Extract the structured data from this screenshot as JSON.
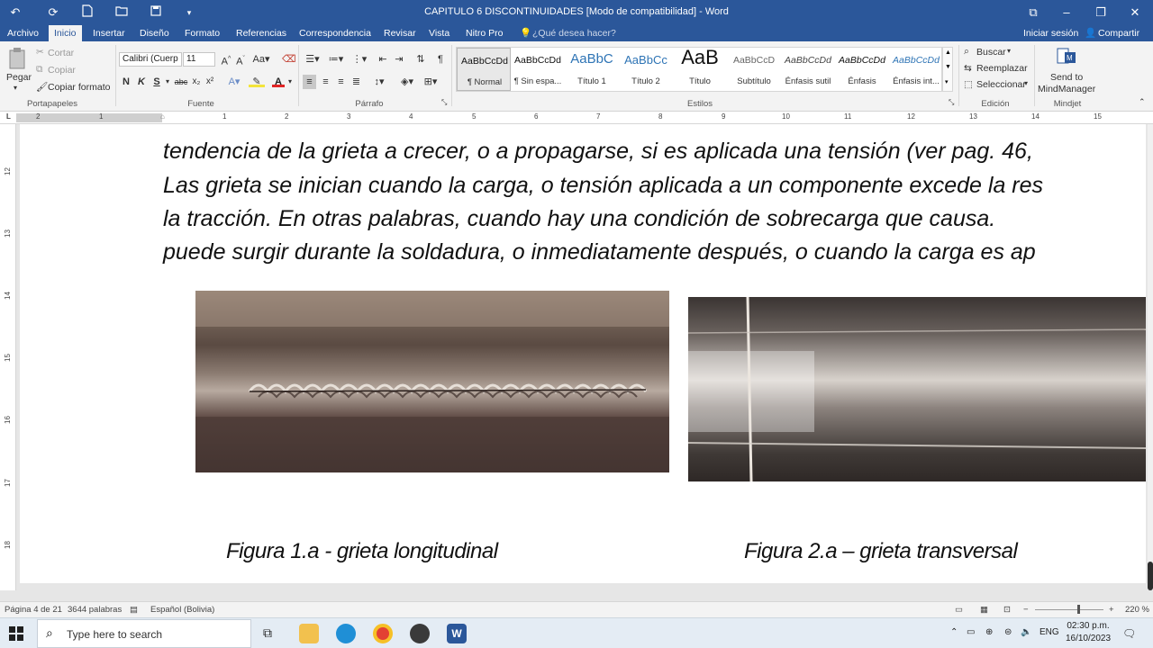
{
  "titlebar": {
    "title": "CAPITULO 6 DISCONTINUIDADES [Modo de compatibilidad] - Word"
  },
  "tabs": {
    "items": [
      "Archivo",
      "Inicio",
      "Insertar",
      "Diseño",
      "Formato",
      "Referencias",
      "Correspondencia",
      "Revisar",
      "Vista",
      "Nitro Pro"
    ],
    "tell_me": "¿Qué desea hacer?",
    "sign_in": "Iniciar sesión",
    "share": "Compartir"
  },
  "ribbon": {
    "clipboard": {
      "paste": "Pegar",
      "cut": "Cortar",
      "copy": "Copiar",
      "format_painter": "Copiar formato",
      "label": "Portapapeles"
    },
    "font": {
      "family": "Calibri (Cuerp",
      "size": "11",
      "label": "Fuente",
      "bold": "N",
      "italic": "K",
      "underline": "S"
    },
    "paragraph": {
      "label": "Párrafo"
    },
    "styles": {
      "label": "Estilos",
      "items": [
        {
          "preview": "AaBbCcDd",
          "name": "¶ Normal"
        },
        {
          "preview": "AaBbCcDd",
          "name": "¶ Sin espa..."
        },
        {
          "preview": "AaBbC",
          "name": "Título 1"
        },
        {
          "preview": "AaBbCc",
          "name": "Título 2"
        },
        {
          "preview": "AaB",
          "name": "Título"
        },
        {
          "preview": "AaBbCcD",
          "name": "Subtítulo"
        },
        {
          "preview": "AaBbCcDd",
          "name": "Énfasis sutil"
        },
        {
          "preview": "AaBbCcDd",
          "name": "Énfasis"
        },
        {
          "preview": "AaBbCcDd",
          "name": "Énfasis int..."
        }
      ]
    },
    "editing": {
      "label": "Edición",
      "find": "Buscar",
      "replace": "Reemplazar",
      "select": "Seleccionar"
    },
    "mindjet": {
      "label": "Mindjet",
      "send": "Send to",
      "app": "MindManager"
    }
  },
  "ruler": {
    "numbers": [
      "2",
      "1",
      "1",
      "2",
      "3",
      "4",
      "5",
      "6",
      "7",
      "8",
      "9",
      "10",
      "11",
      "12",
      "13",
      "14",
      "15"
    ],
    "vertical_numbers": [
      "12",
      "13",
      "14",
      "15",
      "16",
      "17",
      "18"
    ]
  },
  "document": {
    "lines": [
      "tendencia de la grieta a crecer, o a propagarse, si es aplicada una tensión (ver pag. 46,",
      "Las grieta se inician cuando la carga, o tensión aplicada a un componente excede la res",
      "la tracción. En otras palabras, cuando hay una condición de sobrecarga que causa.",
      "puede surgir durante la soldadura, o inmediatamente después, o cuando la carga es ap"
    ],
    "captions": [
      "Figura 1.a - grieta longitudinal",
      "Figura 2.a – grieta transversal"
    ]
  },
  "statusbar": {
    "page": "Página 4 de 21",
    "words": "3644 palabras",
    "language": "Español (Bolivia)",
    "zoom": "220 %"
  },
  "taskbar": {
    "search_placeholder": "Type here to search",
    "lang": "ENG",
    "time": "02:30 p.m.",
    "date": "16/10/2023"
  }
}
